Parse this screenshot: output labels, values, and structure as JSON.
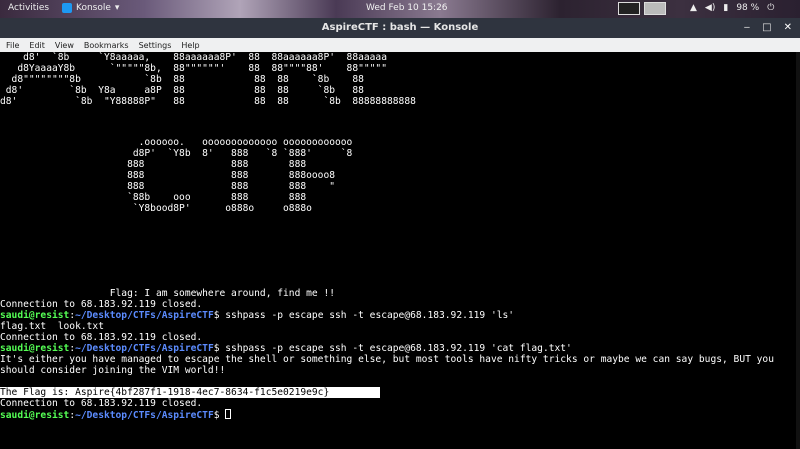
{
  "panel": {
    "activities": "Activities",
    "app_name": "Konsole",
    "app_arrow": "▾",
    "clock": "Wed Feb 10  15:26",
    "battery": "98 %"
  },
  "window": {
    "title": "AspireCTF : bash — Konsole",
    "minimize_icon": "‒",
    "maximize_icon": "□",
    "close_icon": "✕"
  },
  "menu": {
    "items": [
      "File",
      "Edit",
      "View",
      "Bookmarks",
      "Settings",
      "Help"
    ]
  },
  "terminal": {
    "banner": [
      "    d8'  `8b     `Y8aaaaa,    88aaaaaa8P'  88  88aaaaaa8P'  88aaaaa",
      "   d8YaaaaY8b      `\"\"\"\"\"8b,  88\"\"\"\"\"\"'    88  88\"\"\"\"88'    88\"\"\"\"\"",
      "  d8\"\"\"\"\"\"\"\"8b           `8b  88            88  88    `8b    88",
      " d8'        `8b  Y8a     a8P  88            88  88     `8b   88",
      "d8'          `8b  \"Y88888P\"   88            88  88      `8b  88888888888"
    ],
    "ctf_art": [
      "                        .oooooo.   ooooooooooooo oooooooooooo",
      "                       d8P'  `Y8b  8'   888   `8 `888'     `8",
      "                      888               888       888",
      "                      888               888       888oooo8",
      "                      888               888       888    \"",
      "                      `88b    ooo       888       888",
      "                       `Y8bood8P'      o888o     o888o"
    ],
    "flag_hint": "                   Flag: I am somewhere around, find me !!",
    "closed_1": "Connection to 68.183.92.119 closed.",
    "prompt_user": "saudi@resist",
    "prompt_sep": ":",
    "prompt_path": "~/Desktop/CTFs/AspireCTF",
    "prompt_dollar": "$ ",
    "cmd_ls": "sshpass -p escape ssh -t escape@68.183.92.119 'ls'",
    "ls_output": "flag.txt  look.txt",
    "closed_2": "Connection to 68.183.92.119 closed.",
    "cmd_cat": "sshpass -p escape ssh -t escape@68.183.92.119 'cat flag.txt'",
    "msg_line1": "It's either you have managed to escape the shell or something else, but most tools have nifty tricks or maybe we can say bugs, BUT you",
    "msg_line2": "should consider joining the VIM world!!",
    "flag": "The Flag is: Aspire{4bf287f1-1918-4ec7-8634-f1c5e0219e9c}",
    "closed_3": "Connection to 68.183.92.119 closed."
  }
}
